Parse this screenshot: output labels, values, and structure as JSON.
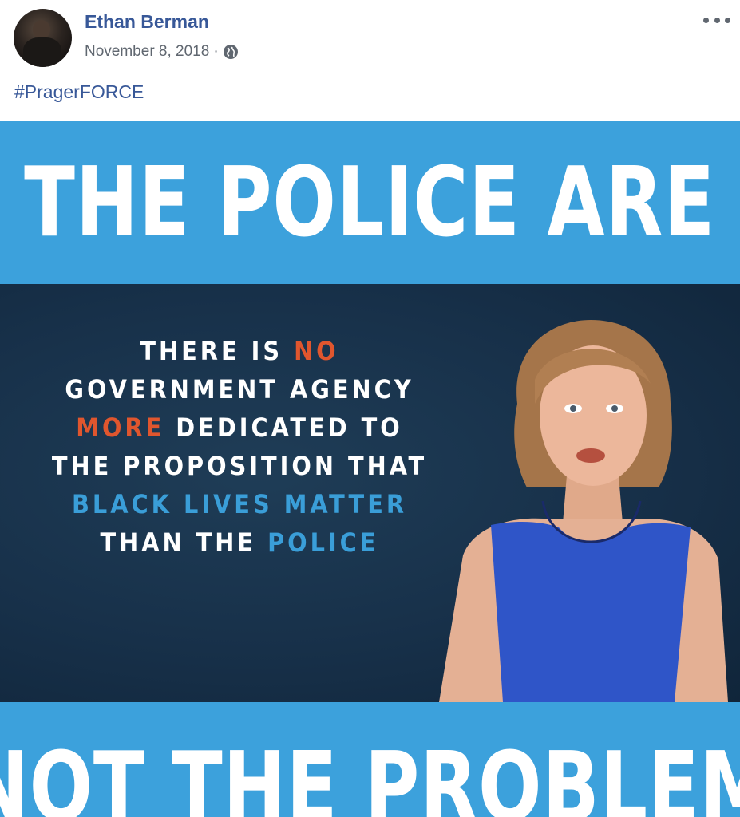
{
  "post": {
    "author": "Ethan Berman",
    "date": "November 8, 2018",
    "separator": "·",
    "privacy_icon": "globe-icon",
    "more_icon": "more-options-icon",
    "hashtag": "#PragerFORCE"
  },
  "video": {
    "headline_top": "THE POLICE ARE",
    "headline_bottom": "NOT THE PROBLEM",
    "quote": {
      "line1_a": "THERE IS ",
      "line1_b": "NO",
      "line2": "GOVERNMENT AGENCY",
      "line3_a": "MORE",
      "line3_b": " DEDICATED TO",
      "line4": "THE PROPOSITION THAT",
      "line5": "BLACK LIVES MATTER",
      "line6_a": "THAN THE ",
      "line6_b": "POLICE"
    }
  },
  "colors": {
    "link": "#385898",
    "band": "#3ca1dc",
    "accent_red": "#e0562e",
    "accent_blue": "#3a9ed8",
    "dark_bg": "#17324a"
  }
}
